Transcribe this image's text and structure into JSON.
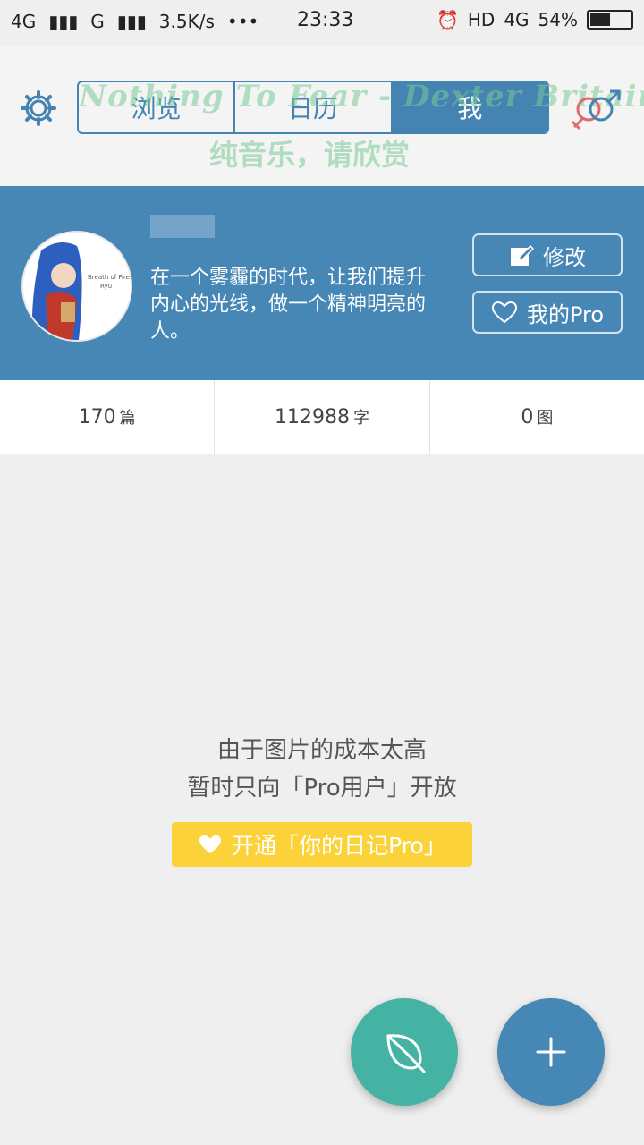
{
  "status_bar": {
    "signal": "4G",
    "signal2": "G",
    "speed": "3.5K/s",
    "dots": "•••",
    "time": "23:33",
    "hd": "HD",
    "network": "4G",
    "battery": "54%"
  },
  "header": {
    "tabs": [
      {
        "label": "浏览"
      },
      {
        "label": "日历"
      },
      {
        "label": "我"
      }
    ],
    "watermark_line1": "Nothing To Fear - Dexter Britain",
    "watermark_line2": "纯音乐，请欣赏"
  },
  "profile": {
    "bio": "在一个雾霾的时代，让我们提升内心的光线，做一个精神明亮的人。",
    "edit_label": "修改",
    "pro_label": "我的Pro",
    "avatar_caption": "Breath of Fire Ryu"
  },
  "stats": [
    {
      "value": "170",
      "unit": "篇"
    },
    {
      "value": "112988",
      "unit": "字"
    },
    {
      "value": "0",
      "unit": "图"
    }
  ],
  "empty_state": {
    "line1": "由于图片的成本太高",
    "line2": "暂时只向「Pro用户」开放",
    "button": "开通「你的日记Pro」"
  },
  "colors": {
    "primary": "#4687b6",
    "accent_yellow": "#fcd23a",
    "leaf_green": "#45b3a4"
  },
  "icons": {
    "settings": "gear-icon",
    "gender": "gender-icon",
    "edit": "edit-icon",
    "heart": "heart-icon",
    "leaf": "leaf-icon",
    "add": "plus-icon"
  }
}
